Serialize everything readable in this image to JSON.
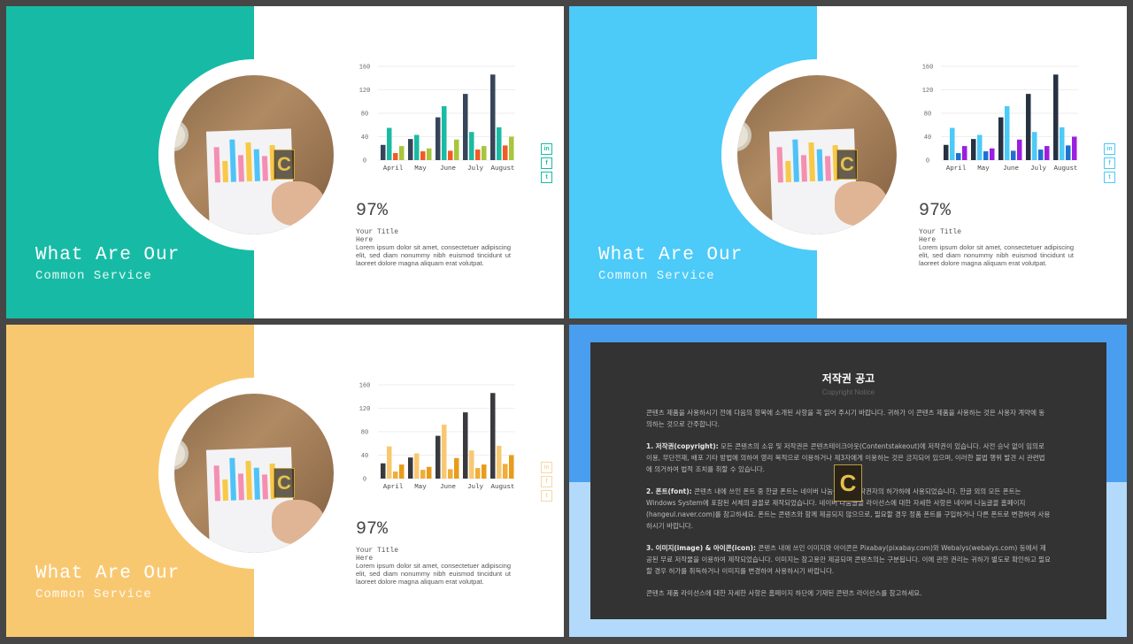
{
  "slides": [
    {
      "accent": "#17bba5",
      "series_colors": [
        "#36455a",
        "#1bbba3",
        "#f25a26",
        "#a7c63b"
      ],
      "social_color": "#17bba5"
    },
    {
      "accent": "#4ccaf8",
      "series_colors": [
        "#263242",
        "#4ccaf8",
        "#1f71d1",
        "#9b1fe0"
      ],
      "social_color": "#4ccaf8"
    },
    {
      "accent": "#f8c871",
      "series_colors": [
        "#3a3a3e",
        "#f8c871",
        "#f0ad3a",
        "#e89c1a"
      ],
      "social_color": "#f3d9a6"
    }
  ],
  "content": {
    "title_line1": "What Are Our",
    "title_line2": "Common Service",
    "percent": "97%",
    "your_title": "Your Title Here",
    "lorem": "Lorem ipsum dolor sit amet, consectetuer adipiscing elit, sed diam nonummy nibh euismod tincidunt ut laoreet dolore magna aliquam erat volutpat.",
    "social": [
      {
        "icon": "linkedin-icon",
        "label": "in"
      },
      {
        "icon": "facebook-icon",
        "label": "f"
      },
      {
        "icon": "twitter-icon",
        "label": "t"
      }
    ]
  },
  "chart_data": {
    "type": "bar",
    "categories": [
      "April",
      "May",
      "June",
      "July",
      "August"
    ],
    "series": [
      {
        "values": [
          26,
          36,
          73,
          113,
          146
        ]
      },
      {
        "values": [
          55,
          43,
          92,
          48,
          56
        ]
      },
      {
        "values": [
          12,
          15,
          16,
          18,
          25
        ]
      },
      {
        "values": [
          24,
          20,
          35,
          24,
          40
        ]
      }
    ],
    "yticks": [
      0,
      40,
      80,
      120,
      160
    ],
    "ylim": [
      0,
      160
    ],
    "grid": true
  },
  "notice": {
    "title": "저작권 공고",
    "subtitle": "Copyright Notice",
    "intro": "콘텐츠 제품을 사용하시기 전에 다음의 항목에 소개된 사항을 꼭 읽어 주시기 바랍니다. 귀하가 이 콘텐츠 제품을 사용하는 것은 사용자 계약에 동의하는 것으로 간주합니다.",
    "p1_head": "1. 저작권(copyright):",
    "p1": " 모든 콘텐츠의 소유 및 저작권은 콘텐츠테이크아웃(Contentstakeout)에 저작권이 있습니다. 사전 승낙 없이 임의로 이용, 무단전재, 배포 기타 방법에 의하여 영리 목적으로 이용하거나 제3자에게 이용하는 것은 금지되어 있으며, 이러한 불법 행위 발견 시 관련법에 의거하여 법적 조치를 취할 수 있습니다.",
    "p2_head": "2. 폰트(font):",
    "p2": " 콘텐츠 내에 쓰인 폰트 중 한글 폰트는 네이버 나눔글꼴의 저작권자의 허가하에 사용되었습니다. 한글 외의 모든 폰트는 Windows System에 포함된 서체의 글꼴로 제작되었습니다. 네이버 나눔글꼴 라이선스에 대한 자세한 사항은 네이버 나눔글꼴 홈페이지(hangeul.naver.com)를 참고하세요. 폰트는 콘텐츠와 함께 제공되지 않으므로, 필요할 경우 정품 폰트를 구입하거나 다른 폰트로 변경하여 사용하시기 바랍니다.",
    "p3_head": "3. 이미지(image) & 아이콘(icon):",
    "p3": " 콘텐츠 내에 쓰인 이미지와 아이콘은 Pixabay(pixabay.com)와 Webalys(webalys.com) 등에서 제공된 무료 저작물을 이용하여 제작되었습니다. 이미지는 참고용만 제공되며 콘텐츠의는 구분됩니다. 이에 관한 권리는 귀하가 별도로 확인하고 필요할 경우 허가를 취득하거나 이미지를 변경하여 사용하시기 바랍니다.",
    "outro": "콘텐츠 제품 라이선스에 대한 자세한 사항은 홈페이지 하단에 기재된 콘텐츠 라이선스를 참고하세요.",
    "logo_letter": "C"
  }
}
